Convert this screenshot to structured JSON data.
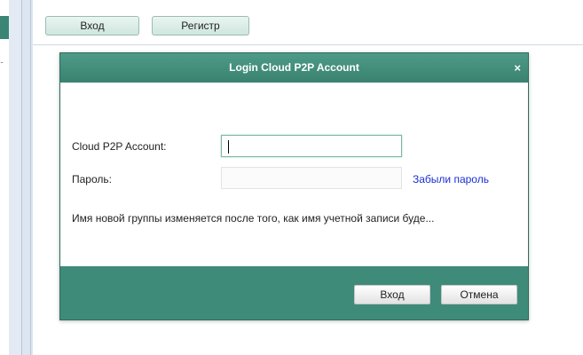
{
  "sidebar": {
    "ellipsis": "..",
    "accent_color": "#3b8574"
  },
  "toolbar": {
    "login_label": "Вход",
    "register_label": "Регистр"
  },
  "dialog": {
    "title": "Login Cloud P2P Account",
    "close_glyph": "×",
    "account_label": "Cloud P2P Account:",
    "account_value": "",
    "password_label": "Пароль:",
    "password_value": "",
    "forgot_link": "Забыли пароль",
    "note": "Имя новой группы изменяется после того, как имя учетной записи буде...",
    "ok_label": "Вход",
    "cancel_label": "Отмена",
    "header_color": "#4a9683",
    "footer_color": "#3f8b79"
  }
}
